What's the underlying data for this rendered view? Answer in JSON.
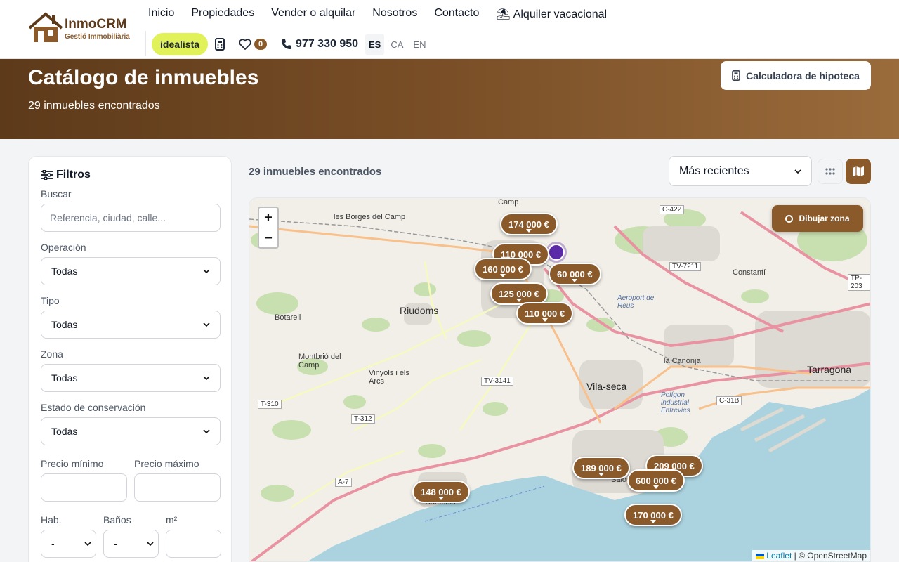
{
  "brand": {
    "name": "InmoCRM",
    "tagline": "Gestió Immobiliària"
  },
  "nav": {
    "items": [
      "Inicio",
      "Propiedades",
      "Vender o alquilar",
      "Nosotros",
      "Contacto"
    ],
    "vacation": "Alquiler vacacional"
  },
  "subnav": {
    "idealista": "idealista",
    "favorites_count": "0",
    "phone": "977 330 950",
    "languages": [
      "ES",
      "CA",
      "EN"
    ],
    "active_language": "ES"
  },
  "hero": {
    "title": "Catálogo de inmuebles",
    "subtitle": "29 inmuebles encontrados",
    "mortgage_button": "Calculadora de hipoteca"
  },
  "filters": {
    "title": "Filtros",
    "search_label": "Buscar",
    "search_placeholder": "Referencia, ciudad, calle...",
    "operation_label": "Operación",
    "operation_value": "Todas",
    "type_label": "Tipo",
    "type_value": "Todas",
    "zone_label": "Zona",
    "zone_value": "Todas",
    "condition_label": "Estado de conservación",
    "condition_value": "Todas",
    "min_price_label": "Precio mínimo",
    "max_price_label": "Precio máximo",
    "rooms_label": "Hab.",
    "rooms_value": "-",
    "baths_label": "Baños",
    "baths_value": "-",
    "area_label": "m²"
  },
  "results": {
    "count_text": "29 inmuebles encontrados",
    "sort_value": "Más recientes"
  },
  "map": {
    "zoom_in": "+",
    "zoom_out": "−",
    "draw_zone": "Dibujar zona",
    "attribution_leaflet": "Leaflet",
    "attribution_osm": "© OpenStreetMap",
    "price_pins": [
      "174 000 €",
      "110 000 €",
      "160 000 €",
      "60 000 €",
      "125 000 €",
      "110 000 €",
      "189 000 €",
      "209 000 €",
      "600 000 €",
      "148 000 €",
      "170 000 €"
    ],
    "places": [
      "les Borges del Camp",
      "Riudoms",
      "Botarell",
      "Montbrió del Camp",
      "Vinyols i els Arcs",
      "Vila-seca",
      "Tarragona",
      "la Canonja",
      "Constantí",
      "Salou",
      "Cambrils",
      "Aeroport de Reus",
      "Polígon industrial Entrevies",
      "Tarragona",
      "Camp"
    ],
    "roads": [
      "C-422",
      "TV-7211",
      "TP-203",
      "TV-3141",
      "T-310",
      "T-312",
      "A-7",
      "C-31B"
    ]
  },
  "colors": {
    "brand": "#8b5a2b",
    "brand_dark": "#5d3a1a",
    "idealista": "#e1f15a",
    "sea": "#aad3df"
  }
}
